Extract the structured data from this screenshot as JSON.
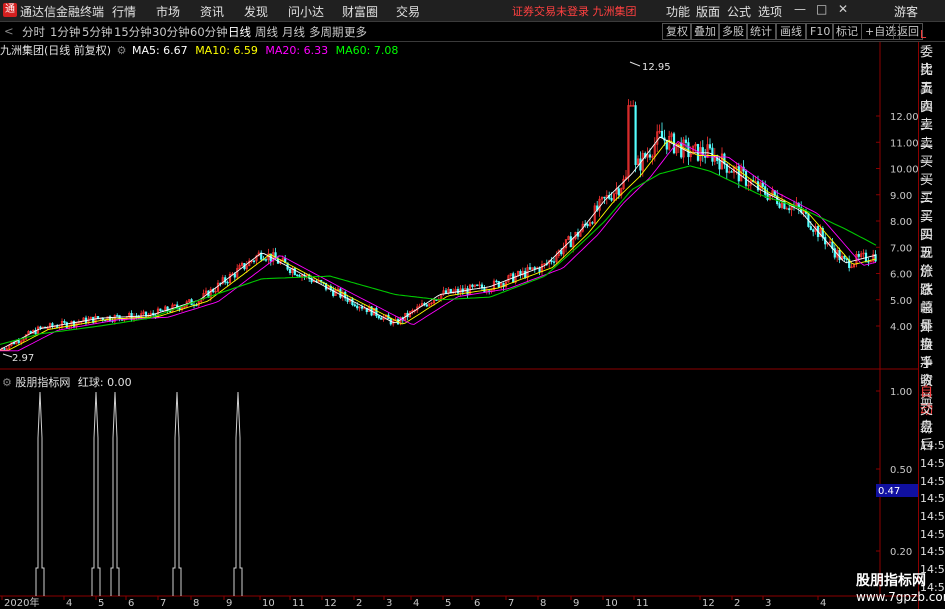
{
  "app": {
    "title": "通达信金融终端",
    "logo": "通"
  },
  "menu": [
    "行情",
    "市场",
    "资讯",
    "发现",
    "问小达",
    "财富圈",
    "交易"
  ],
  "notice": "证券交易未登录  九洲集团",
  "right_menu": [
    "功能",
    "版面",
    "公式",
    "选项"
  ],
  "guest": "游客",
  "window_buttons": [
    "—",
    "□",
    "✕"
  ],
  "toolbar": {
    "periods": [
      "分时",
      "1分钟",
      "5分钟",
      "15分钟",
      "30分钟",
      "60分钟",
      "日线",
      "周线",
      "月线",
      "多周期",
      "更多"
    ],
    "active": "日线",
    "right": [
      "复权",
      "叠加",
      "多股",
      "统计",
      "画线",
      "F10",
      "标记",
      "+自选",
      "返回"
    ]
  },
  "stock": {
    "name": "九洲集团(日线 前复权)"
  },
  "ma": [
    {
      "label": "MA5: 6.67",
      "color": "#ffffff"
    },
    {
      "label": "MA10: 6.59",
      "color": "#ffff00"
    },
    {
      "label": "MA20: 6.33",
      "color": "#ff00ff"
    },
    {
      "label": "MA60: 7.08",
      "color": "#00ff00"
    }
  ],
  "price_axis": [
    "12.00",
    "11.00",
    "10.00",
    "9.00",
    "8.00",
    "7.00",
    "6.00",
    "5.00",
    "4.00"
  ],
  "price_labels": {
    "high": "12.95",
    "low": "2.97"
  },
  "sub": {
    "title": "股朋指标网",
    "value_label": "红球: 0.00",
    "axis": [
      "1.00",
      "0.50",
      "0.20"
    ],
    "current": "0.47"
  },
  "x_axis": [
    "2020年",
    "4",
    "5",
    "6",
    "7",
    "8",
    "9",
    "10",
    "11",
    "12",
    "2",
    "3",
    "4",
    "5",
    "6",
    "7",
    "8",
    "9",
    "10",
    "11",
    "12",
    "2",
    "3",
    "4"
  ],
  "right_panel": [
    "委比",
    "卖五",
    "卖四",
    "卖三",
    "卖二",
    "卖一",
    "买一",
    "买二",
    "买三",
    "买四",
    "买五",
    "现价",
    "涨跌",
    "涨幅",
    "总量",
    "外盘",
    "换手",
    "净资",
    "收益"
  ],
  "right_panel_lower": [
    "自动",
    "交易",
    "盘后",
    "14:56",
    "14:56",
    "14:56",
    "14:56",
    "14:56",
    "14:56",
    "14:56",
    "14:56",
    "14:56"
  ],
  "watermark": {
    "name": "股朋指标网",
    "url": "www.7gpzb.com"
  },
  "chart_data": {
    "type": "line",
    "x": [
      "2020-01",
      "2020-03",
      "2020-05",
      "2020-07",
      "2020-09",
      "2020-10",
      "2020-11",
      "2020-12",
      "2021-02",
      "2021-04",
      "2021-06",
      "2021-07",
      "2021-08",
      "2021-09",
      "2021-10",
      "2021-11",
      "2021-12",
      "2022-01",
      "2022-02",
      "2022-03",
      "2022-04"
    ],
    "series": [
      {
        "name": "MA5",
        "values": [
          3.1,
          3.9,
          4.3,
          4.4,
          5.0,
          6.8,
          5.4,
          4.1,
          5.2,
          5.5,
          6.3,
          7.6,
          8.8,
          9.8,
          11.2,
          10.6,
          10.6,
          9.2,
          8.4,
          6.4,
          6.7
        ]
      },
      {
        "name": "MA60",
        "values": [
          3.3,
          3.7,
          4.0,
          4.3,
          5.0,
          5.8,
          5.9,
          5.2,
          5.0,
          5.1,
          5.9,
          7.1,
          8.0,
          9.2,
          9.8,
          10.1,
          9.9,
          9.0,
          8.5,
          7.7,
          7.08
        ]
      }
    ],
    "ylim": [
      2.5,
      13.5
    ],
    "annotations": [
      "12.95",
      "2.97"
    ]
  }
}
